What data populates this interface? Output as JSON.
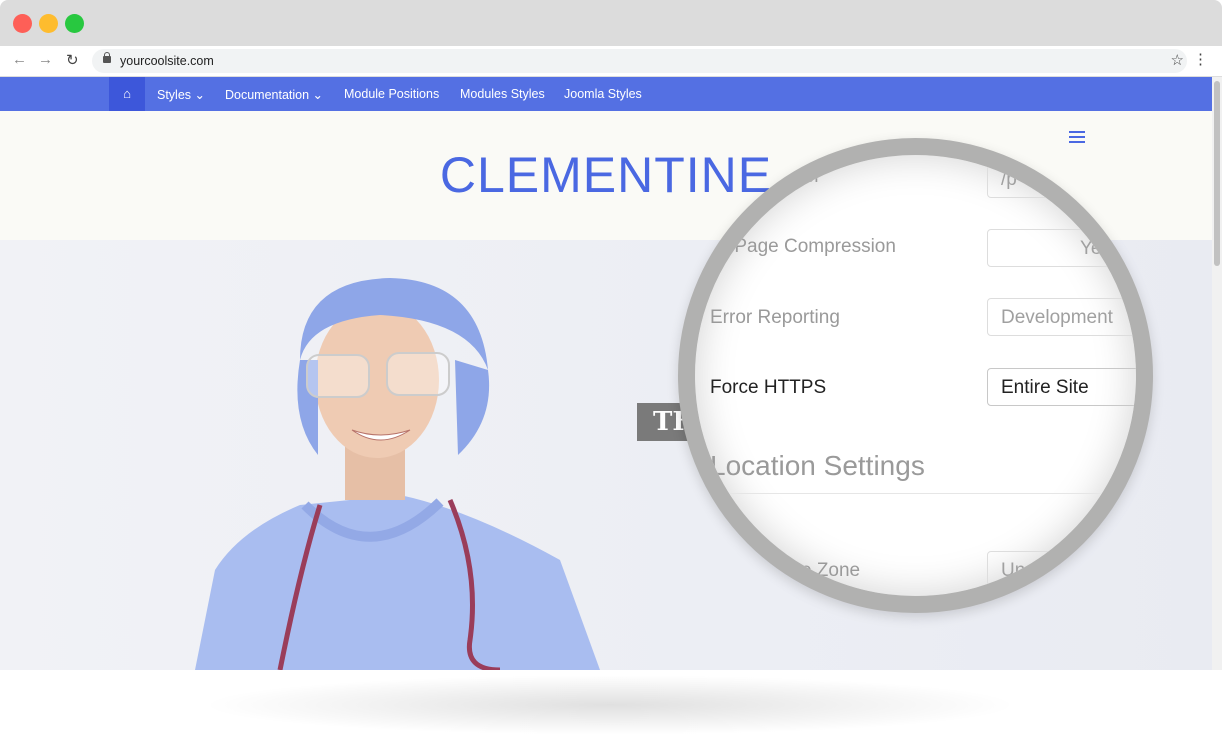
{
  "browser": {
    "url": "yourcoolsite.com",
    "window_buttons": [
      "close",
      "minimize",
      "maximize"
    ],
    "colors": {
      "close": "#fe5f57",
      "minimize": "#febc2e",
      "maximize": "#28c840"
    }
  },
  "nav": {
    "home_icon": "home-icon",
    "items": [
      {
        "label": "Styles",
        "dropdown": true
      },
      {
        "label": "Documentation",
        "dropdown": true
      },
      {
        "label": "Module Positions"
      },
      {
        "label": "Modules Styles"
      },
      {
        "label": "Joomla Styles"
      }
    ],
    "color": "#5470e3"
  },
  "header": {
    "brand": "CLEMENTINE",
    "menu_icon": "hamburger-icon"
  },
  "hero": {
    "caption_fragment": "TH"
  },
  "magnifier": {
    "rows": [
      {
        "label": "Temp Folder",
        "value": "/p"
      },
      {
        "label": "Gzip Page Compression",
        "value": "Yes"
      },
      {
        "label": "Error Reporting",
        "value": "Development"
      },
      {
        "label": "Force HTTPS",
        "value": "Entire Site"
      }
    ],
    "section": "Location Settings",
    "time_zone": {
      "label": "Time Zone",
      "value": "Un"
    }
  }
}
